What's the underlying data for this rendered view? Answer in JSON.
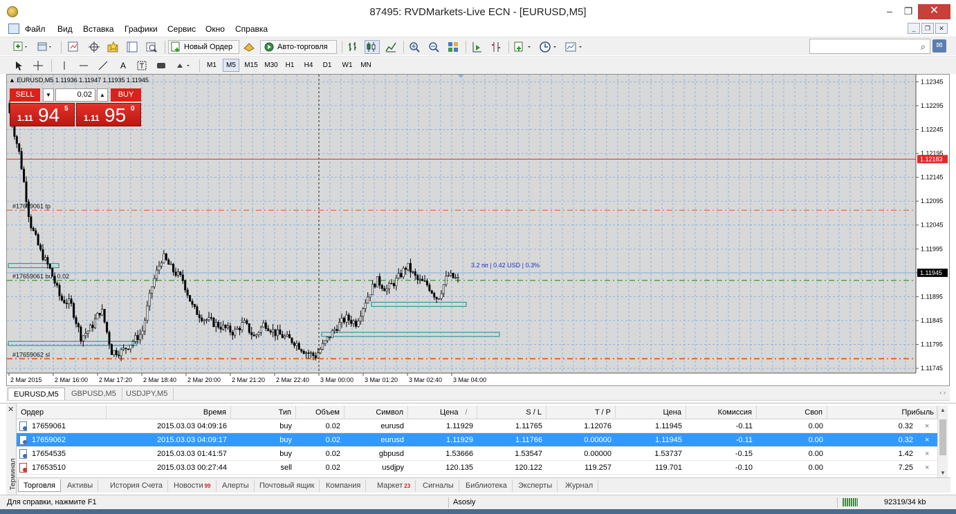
{
  "window": {
    "title": "87495: RVDMarkets-Live ECN - [EURUSD,M5]",
    "minimize": "–",
    "maximize": "❐",
    "close": "✕"
  },
  "menu": [
    "Файл",
    "Вид",
    "Вставка",
    "Графики",
    "Сервис",
    "Окно",
    "Справка"
  ],
  "mdi": {
    "minimize": "_",
    "restore": "❐",
    "close": "✕"
  },
  "toolbar": {
    "new_order": "Новый Ордер",
    "auto_trading": "Авто-торговля",
    "search_icon": "⌕"
  },
  "timeframes": [
    "M1",
    "M5",
    "M15",
    "M30",
    "H1",
    "H4",
    "D1",
    "W1",
    "MN"
  ],
  "active_timeframe": "M5",
  "chart": {
    "info": "▲ EURUSD,M5  1.11936 1.11947 1.11935 1.11945",
    "sell_label": "SELL",
    "buy_label": "BUY",
    "lot": "0.02",
    "dropdown_arrow": "▼",
    "spin_arrow": "▲",
    "sell_price": {
      "prefix": "1.11",
      "big": "94",
      "sup": "5"
    },
    "buy_price": {
      "prefix": "1.11",
      "big": "95",
      "sup": "0"
    },
    "tp_label": "#17659061 tp",
    "order_label": "#17659061 buy 0.02",
    "sl_label": "#17659062 sl",
    "profit_note": "3.2 пп | 0.42 USD | 0.3%",
    "current_price_tag": "1.11945",
    "red_line_tag": "1.12183",
    "colors": {
      "red_line": "#e02a2a",
      "tp_line": "#e8641e",
      "entry_line": "#2e9a2e",
      "bid_line": "#7fb0e0",
      "grid": "#6aa8e8"
    }
  },
  "chart_data": {
    "type": "candlestick",
    "symbol": "EURUSD,M5",
    "y_ticks": [
      "1.12345",
      "1.12295",
      "1.12245",
      "1.12195",
      "1.12145",
      "1.12095",
      "1.12045",
      "1.11995",
      "1.11945",
      "1.11895",
      "1.11845",
      "1.11795",
      "1.11745"
    ],
    "x_ticks": [
      "2 Mar 2015",
      "2 Mar 16:00",
      "2 Mar 17:20",
      "2 Mar 18:40",
      "2 Mar 20:00",
      "2 Mar 21:20",
      "2 Mar 22:40",
      "3 Mar 00:00",
      "3 Mar 01:20",
      "3 Mar 02:40",
      "3 Mar 04:00"
    ],
    "ylim": [
      1.11735,
      1.1236
    ],
    "levels": {
      "red": 1.12183,
      "tp": 1.12076,
      "entry": 1.11929,
      "sl": 1.11765,
      "bid": 1.11945
    },
    "close_path": [
      1.1228,
      1.1219,
      1.1205,
      1.1199,
      1.1195,
      1.1189,
      1.1188,
      1.1181,
      1.1183,
      1.1187,
      1.1178,
      1.1178,
      1.118,
      1.1182,
      1.1192,
      1.1198,
      1.1195,
      1.1193,
      1.1187,
      1.1185,
      1.1184,
      1.1183,
      1.1182,
      1.1184,
      1.1181,
      1.1184,
      1.1182,
      1.1181,
      1.118,
      1.1178,
      1.1177,
      1.118,
      1.1183,
      1.1185,
      1.1184,
      1.1189,
      1.1193,
      1.1191,
      1.1193,
      1.1196,
      1.1193,
      1.1192,
      1.1189,
      1.1194,
      1.1193
    ],
    "grid": true
  },
  "chart_tabs": [
    "EURUSD,M5",
    "GBPUSD,M5",
    "USDJPY,M5"
  ],
  "terminal": {
    "side_label": "Терминал",
    "close": "✕",
    "columns": [
      "Ордер",
      "Время",
      "Тип",
      "Объем",
      "Символ",
      "Цена",
      "S / L",
      "T / P",
      "Цена",
      "Комиссия",
      "Своп",
      "Прибыль"
    ],
    "sort_marker": "/",
    "rows": [
      {
        "order": "17659061",
        "time": "2015.03.03 04:09:16",
        "type": "buy",
        "volume": "0.02",
        "symbol": "eurusd",
        "price": "1.11929",
        "sl": "1.11765",
        "tp": "1.12076",
        "cur": "1.11945",
        "commission": "-0.11",
        "swap": "0.00",
        "profit": "0.32",
        "selected": false,
        "side": "buy"
      },
      {
        "order": "17659062",
        "time": "2015.03.03 04:09:17",
        "type": "buy",
        "volume": "0.02",
        "symbol": "eurusd",
        "price": "1.11929",
        "sl": "1.11766",
        "tp": "0.00000",
        "cur": "1.11945",
        "commission": "-0.11",
        "swap": "0.00",
        "profit": "0.32",
        "selected": true,
        "side": "buy"
      },
      {
        "order": "17654535",
        "time": "2015.03.03 01:41:57",
        "type": "buy",
        "volume": "0.02",
        "symbol": "gbpusd",
        "price": "1.53666",
        "sl": "1.53547",
        "tp": "0.00000",
        "cur": "1.53737",
        "commission": "-0.15",
        "swap": "0.00",
        "profit": "1.42",
        "selected": false,
        "side": "buy"
      },
      {
        "order": "17653510",
        "time": "2015.03.03 00:27:44",
        "type": "sell",
        "volume": "0.02",
        "symbol": "usdjpy",
        "price": "120.135",
        "sl": "120.122",
        "tp": "119.257",
        "cur": "119.701",
        "commission": "-0.10",
        "swap": "0.00",
        "profit": "7.25",
        "selected": false,
        "side": "sell"
      }
    ],
    "tabs": [
      {
        "label": "Торговля",
        "badge": ""
      },
      {
        "label": "Активы",
        "badge": ""
      },
      {
        "label": "История Счета",
        "badge": ""
      },
      {
        "label": "Новости",
        "badge": "99"
      },
      {
        "label": "Алерты",
        "badge": ""
      },
      {
        "label": "Почтовый ящик",
        "badge": ""
      },
      {
        "label": "Компания",
        "badge": ""
      },
      {
        "label": "Маркет",
        "badge": "23"
      },
      {
        "label": "Сигналы",
        "badge": ""
      },
      {
        "label": "Библиотека",
        "badge": ""
      },
      {
        "label": "Эксперты",
        "badge": ""
      },
      {
        "label": "Журнал",
        "badge": ""
      }
    ]
  },
  "status": {
    "help": "Для справки, нажмите F1",
    "profile": "Asosiy",
    "traffic": "92319/34 kb"
  }
}
